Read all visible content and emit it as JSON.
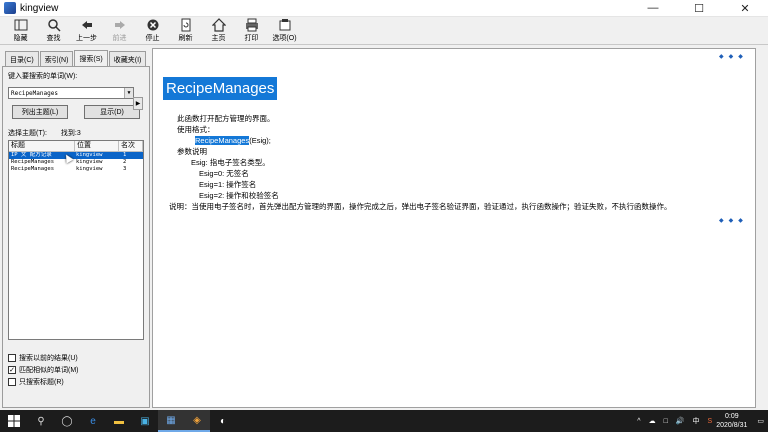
{
  "window": {
    "title": "kingview",
    "controls": [
      "—",
      "☐",
      "✕"
    ]
  },
  "toolbar": [
    {
      "label": "隐藏",
      "icon": "hide-icon",
      "enabled": true
    },
    {
      "label": "查找",
      "icon": "find-icon",
      "enabled": true
    },
    {
      "label": "上一步",
      "icon": "back-arrow-icon",
      "enabled": true
    },
    {
      "label": "前进",
      "icon": "forward-arrow-icon",
      "enabled": false
    },
    {
      "label": "停止",
      "icon": "stop-icon",
      "enabled": true
    },
    {
      "label": "刷新",
      "icon": "refresh-icon",
      "enabled": true
    },
    {
      "label": "主页",
      "icon": "home-icon",
      "enabled": true
    },
    {
      "label": "打印",
      "icon": "print-icon",
      "enabled": true
    },
    {
      "label": "选项(O)",
      "icon": "options-icon",
      "enabled": true
    }
  ],
  "left": {
    "tabs": [
      "目录(C)",
      "索引(N)",
      "搜索(S)",
      "收藏夹(I)"
    ],
    "active_tab": 2,
    "prompt": "键入要搜索的单词(W):",
    "search_value": "RecipeManages",
    "arrow": "▶",
    "list_topics_btn": "列出主题(L)",
    "display_btn": "显示(D)",
    "select_topic_label": "选择主题(T):",
    "found_label": "找到:3",
    "columns": [
      "标题",
      "位置",
      "名次"
    ],
    "rows": [
      {
        "title": "IP 文 配方记录",
        "location": "kingview",
        "rank": "1",
        "selected": true
      },
      {
        "title": "RecipeManages",
        "location": "kingview",
        "rank": "2",
        "selected": false
      },
      {
        "title": "RecipeManages",
        "location": "kingview",
        "rank": "3",
        "selected": false
      }
    ],
    "checks": [
      {
        "label": "搜索以前的结果(U)",
        "checked": false
      },
      {
        "label": "匹配相似的单词(M)",
        "checked": true
      },
      {
        "label": "只搜索标题(R)",
        "checked": false
      }
    ]
  },
  "content": {
    "title": "RecipeManages",
    "nav_arrows": [
      "◆",
      "◆",
      "◆"
    ],
    "line1": "此函数打开配方管理的界面。",
    "usage_label": "使用格式：",
    "usage_fn": "RecipeManages",
    "usage_args": "(Esig);",
    "params_label": "参数说明",
    "param_esig": "Esig: 指电子签名类型。",
    "opt0": "Esig=0: 无签名",
    "opt1": "Esig=1: 操作签名",
    "opt2": "Esig=2: 操作和校验签名",
    "note": "说明：当使用电子签名时，首先弹出配方管理的界面，操作完成之后，弹出电子签名验证界面，验证通过，执行函数操作；验证失败，不执行函数操作。"
  },
  "taskbar": {
    "tray": [
      "^",
      "☁",
      "□",
      "🔊",
      "中",
      "S"
    ],
    "time": "0:09",
    "date": "2020/8/31"
  }
}
